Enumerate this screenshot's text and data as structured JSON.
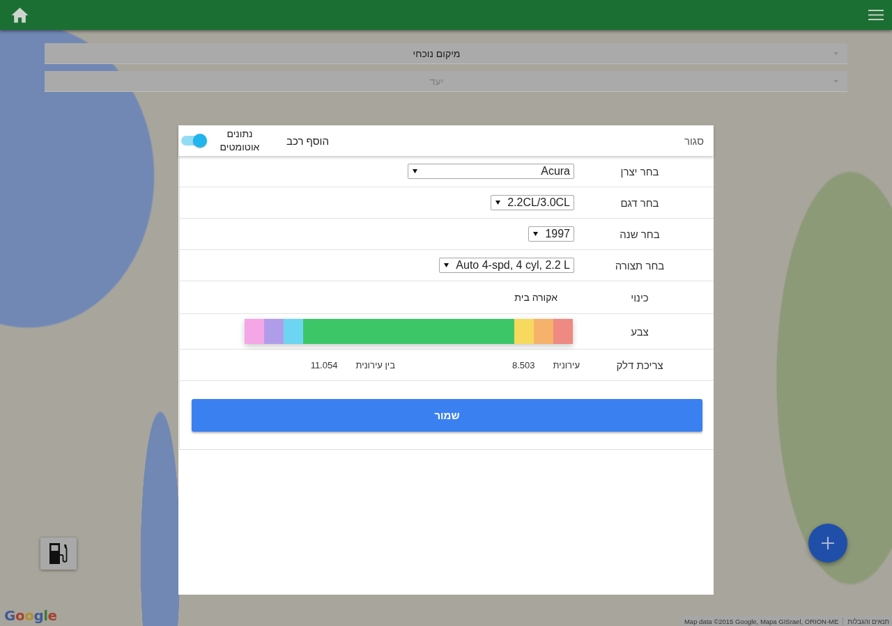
{
  "route_fields": [
    {
      "value": "מיקום נוכחי"
    },
    {
      "placeholder": "יעד"
    }
  ],
  "dialog": {
    "close": "סגור",
    "title": "הוסף רכב",
    "auto_data": {
      "label": "נתונים אוטומטים",
      "on": true
    }
  },
  "form_rows": [
    {
      "kind": "select",
      "label": "בחר יצרן",
      "value": "Acura"
    },
    {
      "kind": "select",
      "label": "בחר דגם",
      "value": "2.2CL/3.0CL"
    },
    {
      "kind": "select",
      "label": "בחר שנה",
      "value": "1997"
    },
    {
      "kind": "select",
      "label": "בחר תצורה",
      "value": "Auto 4-spd, 4 cyl, 2.2 L"
    },
    {
      "kind": "text",
      "label": "כינוי",
      "value": "אקורה בית"
    },
    {
      "kind": "colors",
      "label": "צבע",
      "swatches": [
        {
          "color": "#ee8a82",
          "selected": false
        },
        {
          "color": "#f6b26b",
          "selected": false
        },
        {
          "color": "#f7d95e",
          "selected": false
        },
        {
          "color": "#3dc668",
          "selected": true
        },
        {
          "color": "#6dd5f2",
          "selected": false
        },
        {
          "color": "#b09de9",
          "selected": false
        },
        {
          "color": "#f5a6e6",
          "selected": false
        }
      ]
    },
    {
      "kind": "fuel",
      "label": "צריכת דלק",
      "readings": [
        {
          "label": "עירונית",
          "value": "8.503"
        },
        {
          "label": "בין עירונית",
          "value": "11.054"
        }
      ]
    }
  ],
  "save_button": "שמור",
  "map": {
    "logo": "Google",
    "attribution": "Map data ©2015 Google, Mapa GISrael, ORION-ME",
    "terms": "תנאים והגבלות"
  }
}
